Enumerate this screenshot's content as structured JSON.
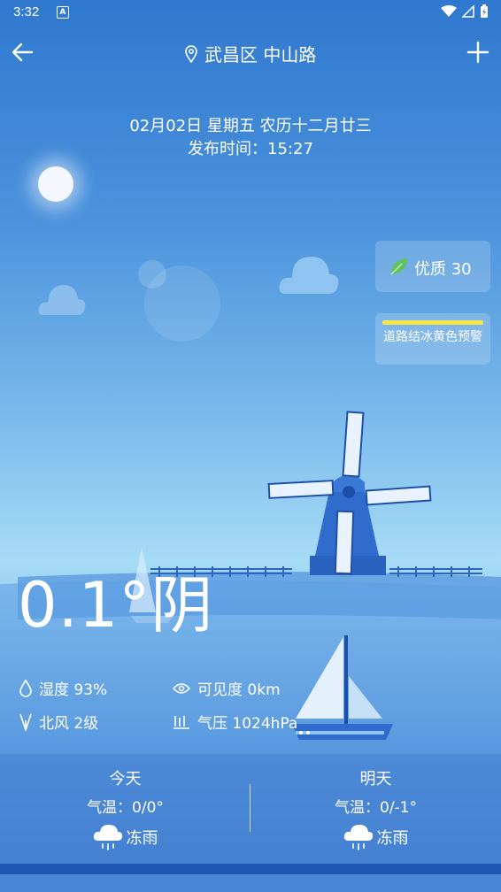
{
  "status_bar": {
    "time": "3:32",
    "app_icon": "A"
  },
  "header": {
    "location": "武昌区 中山路"
  },
  "date": {
    "line": "02月02日 星期五 农历十二月廿三",
    "publish": "发布时间：15:27"
  },
  "aqi": {
    "label": "优质 30"
  },
  "warning": {
    "label": "道路结冰黄色预警",
    "color": "#f6e64a"
  },
  "current": {
    "temperature": "0.1°",
    "condition": "阴"
  },
  "details": {
    "humidity": "湿度 93%",
    "visibility": "可见度 0km",
    "wind": "北风 2级",
    "pressure": "气压 1024hPa"
  },
  "forecast": {
    "today": {
      "title": "今天",
      "temp": "气温：0/0°",
      "condition": "冻雨"
    },
    "tomorrow": {
      "title": "明天",
      "temp": "气温：0/-1°",
      "condition": "冻雨"
    }
  },
  "icons": [
    "back-arrow-icon",
    "location-pin-icon",
    "plus-icon",
    "leaf-icon",
    "humidity-drop-icon",
    "eye-icon",
    "wind-icon",
    "pressure-icon",
    "freezing-rain-icon"
  ]
}
